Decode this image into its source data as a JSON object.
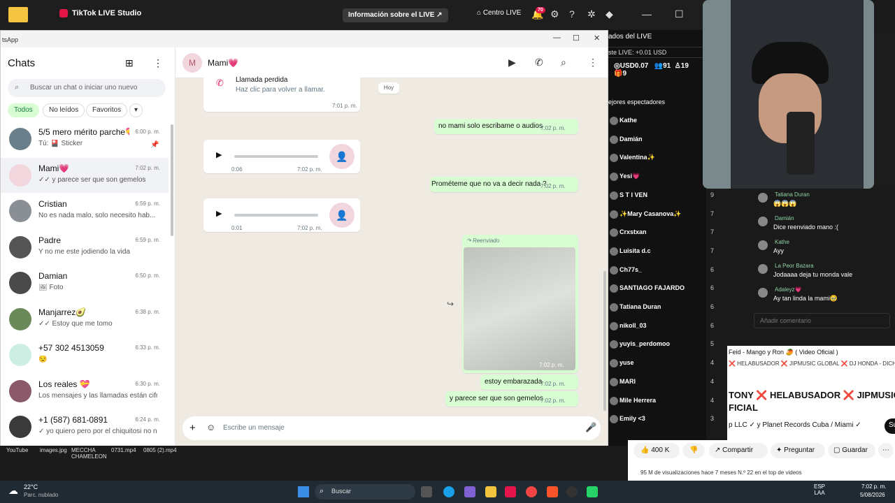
{
  "top_bar": {
    "app_title": "TikTok LIVE Studio",
    "info_button": "Información sobre el LIVE",
    "centro_live": "Centro LIVE",
    "notification_count": "70"
  },
  "whatsapp": {
    "window_title": "tsApp",
    "left": {
      "title": "Chats",
      "search_placeholder": "Buscar un chat o iniciar uno nuevo",
      "filters": [
        "Todos",
        "No leídos",
        "Favoritos"
      ],
      "chats": [
        {
          "name": "5/5 mero mérito parche💝",
          "time": "6:00 p. m.",
          "preview": "Tú: 🎴 Sticker"
        },
        {
          "name": "Mami💗",
          "time": "7:02 p. m.",
          "preview": "✓✓ y parece ser que son gemelos"
        },
        {
          "name": "Cristian",
          "time": "6:59 p. m.",
          "preview": "No es nada malo, solo necesito hab..."
        },
        {
          "name": "Padre",
          "time": "6:59 p. m.",
          "preview": "Y no me este jodiendo la vida"
        },
        {
          "name": "Damian",
          "time": "6:50 p. m.",
          "preview": "🖼 Foto"
        },
        {
          "name": "Manjarrez🥑",
          "time": "6:38 p. m.",
          "preview": "✓✓ Estoy que me tomo"
        },
        {
          "name": "+57 302 4513059",
          "time": "6:33 p. m.",
          "preview": "😒"
        },
        {
          "name": "Los reales 💝",
          "time": "6:30 p. m.",
          "preview": "Los mensajes y las llamadas están cifr..."
        },
        {
          "name": "+1 (587) 681-0891",
          "time": "6:24 p. m.",
          "preview": "✓ yo quiero pero por el chiquitosi no no"
        }
      ]
    },
    "conversation": {
      "contact": "Mami💗",
      "avatar_letter": "M",
      "missed_call": "Llamada perdida",
      "missed_call_sub": "Haz clic para volver a llamar.",
      "missed_call_time": "7:01 p. m.",
      "day_label": "Hoy",
      "messages": [
        {
          "text": "no mami solo escribame o audios",
          "time": "7:02 p. m."
        },
        {
          "text": "Prométeme que no va a decir nada ?",
          "time": "7:02 p. m."
        },
        {
          "text": "estoy embarazada",
          "time": "7:02 p. m."
        },
        {
          "text": "y parece ser que son gemelos",
          "time": "7:02 p. m."
        }
      ],
      "audios": [
        {
          "duration": "0:06",
          "time": "7:02 p. m."
        },
        {
          "duration": "0:01",
          "time": "7:02 p. m."
        }
      ],
      "forwarded_label": "Reenviado",
      "image_time": "7:02 p. m.",
      "composer_placeholder": "Escribe un mensaje"
    }
  },
  "tiktok_side": {
    "header": "ados del LIVE",
    "earn": "ste LIVE: +0.01 USD",
    "stats": [
      "USD0.07",
      "91",
      "19",
      "9"
    ],
    "viewers_title": "ejores espectadores",
    "viewers": [
      {
        "name": "Kathe",
        "score": ""
      },
      {
        "name": "Damián",
        "score": ""
      },
      {
        "name": "Valentina✨",
        "score": ""
      },
      {
        "name": "Yesi💗",
        "score": ""
      },
      {
        "name": "S T I VEN",
        "score": "9"
      },
      {
        "name": "✨Mary Casanova✨",
        "score": "7"
      },
      {
        "name": "Crxstxan",
        "score": "7"
      },
      {
        "name": "Luisita d.c",
        "score": "7"
      },
      {
        "name": "Ch77s_",
        "score": "6"
      },
      {
        "name": "SANTIAGO FAJARDO",
        "score": "6"
      },
      {
        "name": "Tatiana Duran",
        "score": "6"
      },
      {
        "name": "nikoll_03",
        "score": "6"
      },
      {
        "name": "yuyis_perdomoo",
        "score": "5"
      },
      {
        "name": "yuse",
        "score": "4"
      },
      {
        "name": "MARI",
        "score": "4"
      },
      {
        "name": "Mile Herrera",
        "score": "4"
      },
      {
        "name": "Emily <3",
        "score": "3"
      }
    ],
    "live_chat": [
      {
        "user": "Tatiana Duran",
        "text": "😱😱😱"
      },
      {
        "user": "Damián",
        "text": "Dice reenviado mano :("
      },
      {
        "user": "Kathe",
        "text": "Ayy"
      },
      {
        "user": "La Peor Bazara",
        "text": "Jodaaaa deja tu monda vale"
      },
      {
        "user": "Adaleyz💗",
        "text": "Ay tan linda la mami🥹"
      }
    ],
    "chat_placeholder": "Añadir comentario"
  },
  "youtube": {
    "song": "Feid - Mango y Ron 🥭 ( Video Oficial )",
    "tags": "❌ HELABUSADOR ❌ JIPMUSIC GLOBAL ❌ DJ HONDA - DICHAVA",
    "title": "TONY ❌ HELABUSADOR ❌ JIPMUSIC\nFICIAL",
    "channel": "p LLC ✓ y Planet Records Cuba / Miami ✓",
    "likes": "400 K",
    "share": "Compartir",
    "ask": "Preguntar",
    "save": "Guardar",
    "subscribe": "Su",
    "views": "95 M de visualizaciones  hace 7 meses  N.º 22 en el top de videos"
  },
  "files": [
    "YouTube",
    "images.jpg",
    "MECCHA\nCHAMELEON",
    "0731.mp4",
    "0805 (2).mp4"
  ],
  "taskbar": {
    "weather_temp": "22°C",
    "weather_desc": "Parc. nublado",
    "search": "Buscar",
    "lang": "ESP\nLAA",
    "time": "7:02 p. m.",
    "date": "5/08/2026"
  }
}
